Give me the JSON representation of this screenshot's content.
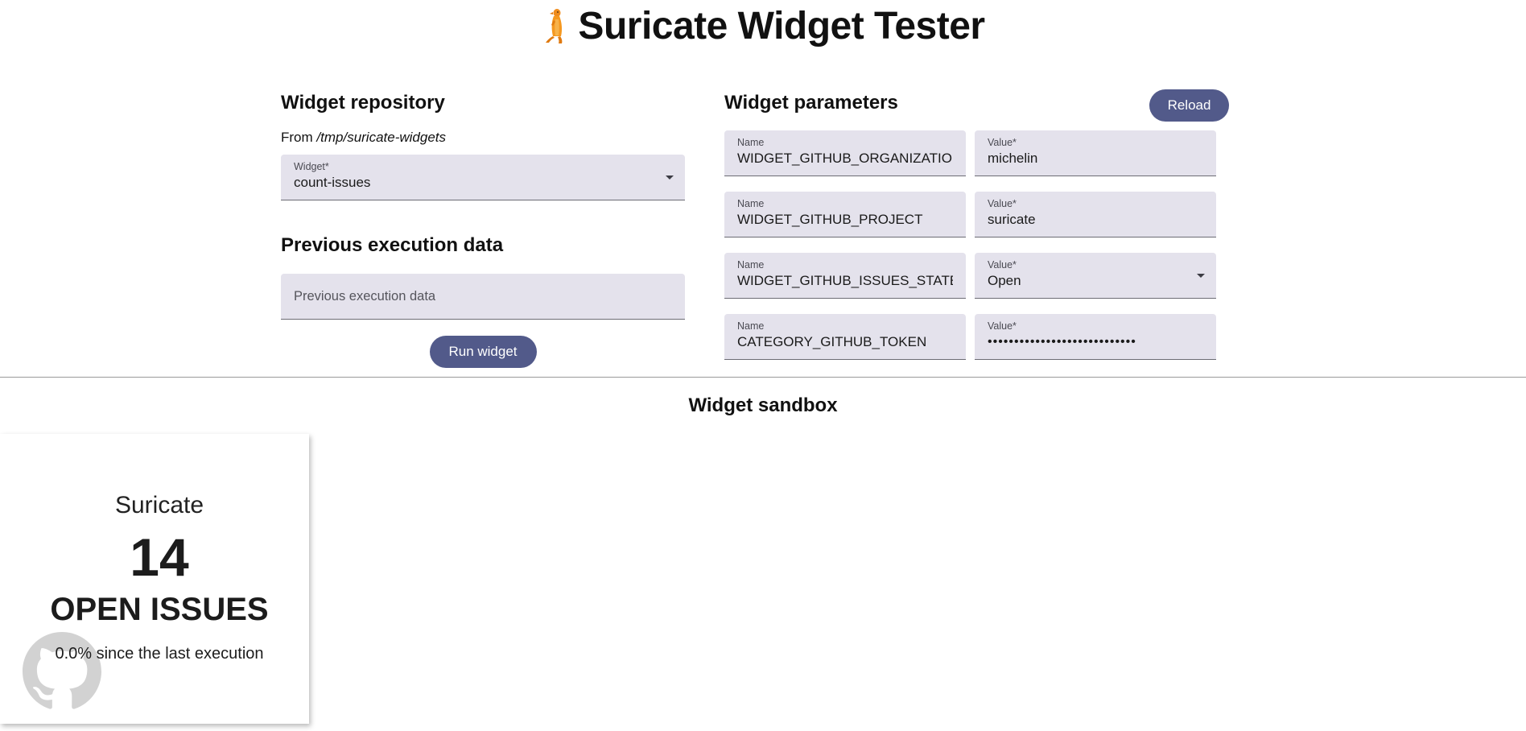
{
  "header": {
    "title": "Suricate Widget Tester",
    "logo_icon": "meerkat-icon"
  },
  "repository": {
    "heading": "Widget repository",
    "from_label": "From",
    "path": "/tmp/suricate-widgets",
    "widget_field_label": "Widget*",
    "widget_value": "count-issues"
  },
  "previous_execution": {
    "heading": "Previous execution data",
    "placeholder": "Previous execution data"
  },
  "run_button_label": "Run widget",
  "parameters": {
    "heading": "Widget parameters",
    "reload_label": "Reload",
    "name_label": "Name",
    "value_label": "Value*",
    "rows": [
      {
        "name": "WIDGET_GITHUB_ORGANIZATION",
        "value": "michelin",
        "type": "text"
      },
      {
        "name": "WIDGET_GITHUB_PROJECT",
        "value": "suricate",
        "type": "text"
      },
      {
        "name": "WIDGET_GITHUB_ISSUES_STATE",
        "value": "Open",
        "type": "select"
      },
      {
        "name": "CATEGORY_GITHUB_TOKEN",
        "value": "••••••••••••••••••••••••••••",
        "type": "password"
      }
    ]
  },
  "sandbox": {
    "heading": "Widget sandbox",
    "card": {
      "title": "Suricate",
      "count": "14",
      "label": "OPEN ISSUES",
      "trend": "0.0% since the last execution",
      "icon": "github-icon"
    }
  },
  "colors": {
    "accent": "#525a8a",
    "field_background": "#e4e2ec",
    "logo_orange": "#f08c1c"
  }
}
